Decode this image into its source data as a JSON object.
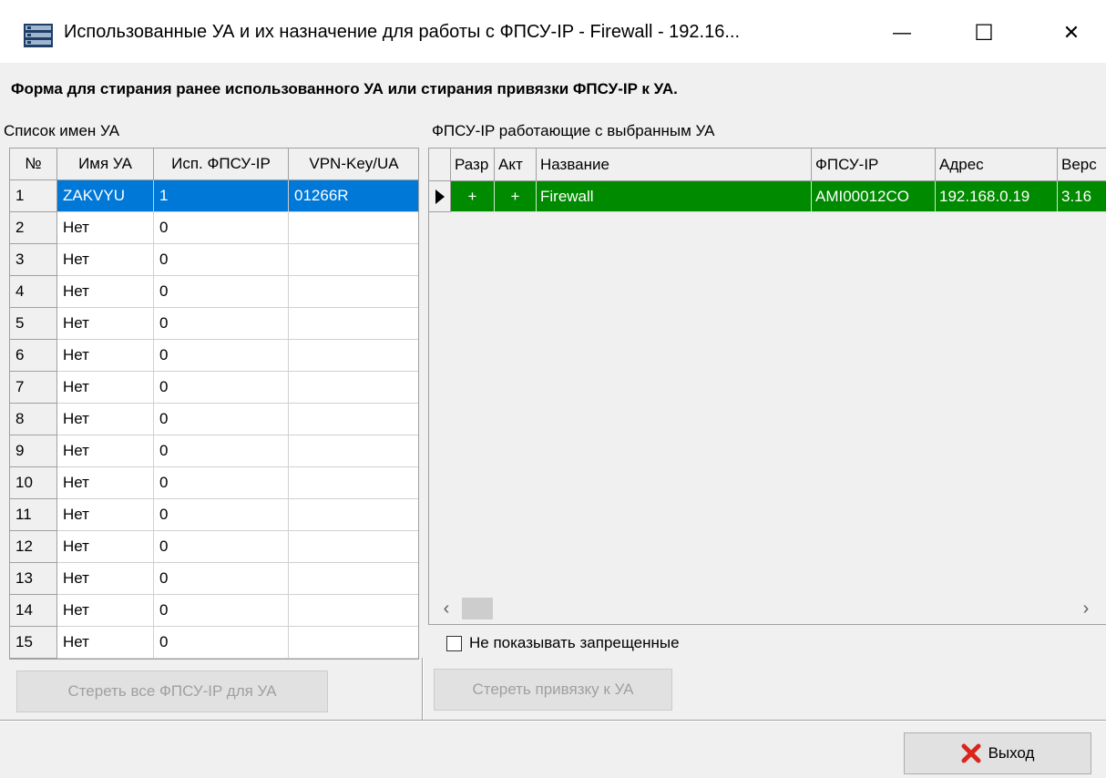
{
  "window": {
    "title": "Использованные УА и их назначение для работы с ФПСУ-IP - Firewall - 192.16...",
    "minimize_glyph": "—",
    "maximize_glyph": "☐",
    "close_glyph": "✕"
  },
  "form": {
    "caption": "Форма для стирания ранее использованного УА или стирания  привязки ФПСУ-IP к УА."
  },
  "left_panel": {
    "label": "Список имен УА",
    "columns": [
      "№",
      "Имя УА",
      "Исп. ФПСУ-IP",
      "VPN-Key/UA"
    ],
    "rows": [
      {
        "num": "1",
        "name": "ZAKVYU",
        "used": "1",
        "key": "01266R"
      },
      {
        "num": "2",
        "name": "Нет",
        "used": "0",
        "key": ""
      },
      {
        "num": "3",
        "name": "Нет",
        "used": "0",
        "key": ""
      },
      {
        "num": "4",
        "name": "Нет",
        "used": "0",
        "key": ""
      },
      {
        "num": "5",
        "name": "Нет",
        "used": "0",
        "key": ""
      },
      {
        "num": "6",
        "name": "Нет",
        "used": "0",
        "key": ""
      },
      {
        "num": "7",
        "name": "Нет",
        "used": "0",
        "key": ""
      },
      {
        "num": "8",
        "name": "Нет",
        "used": "0",
        "key": ""
      },
      {
        "num": "9",
        "name": "Нет",
        "used": "0",
        "key": ""
      },
      {
        "num": "10",
        "name": "Нет",
        "used": "0",
        "key": ""
      },
      {
        "num": "11",
        "name": "Нет",
        "used": "0",
        "key": ""
      },
      {
        "num": "12",
        "name": "Нет",
        "used": "0",
        "key": ""
      },
      {
        "num": "13",
        "name": "Нет",
        "used": "0",
        "key": ""
      },
      {
        "num": "14",
        "name": "Нет",
        "used": "0",
        "key": ""
      },
      {
        "num": "15",
        "name": "Нет",
        "used": "0",
        "key": ""
      }
    ],
    "erase_all_button": "Стереть  все ФПСУ-IP для УА"
  },
  "right_panel": {
    "label": "ФПСУ-IP работающие с выбранным УА",
    "columns": [
      "Разр",
      "Акт",
      "Название",
      "ФПСУ-IP",
      "Адрес",
      "Верс"
    ],
    "rows": [
      {
        "allowed": "+",
        "active": "+",
        "name": "Firewall",
        "fpsu": "AMI00012CO",
        "address": "192.168.0.19",
        "version": "3.16"
      }
    ],
    "hide_forbidden_label": "Не показывать запрещенные",
    "erase_binding_button": "Стереть привязку к УА"
  },
  "footer": {
    "exit_button": "Выход"
  },
  "colors": {
    "selection": "#0078d7",
    "active_row": "#008a00",
    "exit_icon": "#d9261c"
  }
}
